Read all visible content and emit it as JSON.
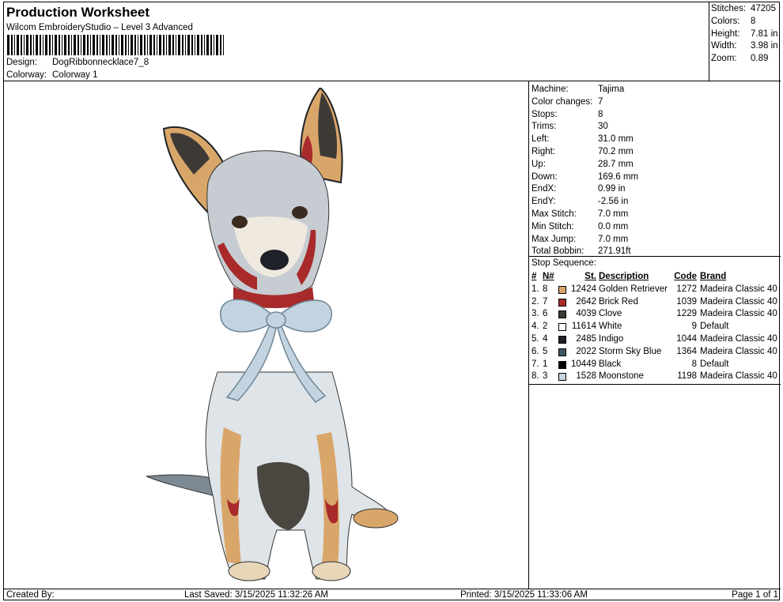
{
  "header": {
    "title": "Production Worksheet",
    "subtitle": "Wilcom EmbroideryStudio – Level 3 Advanced",
    "design_label": "Design:",
    "design_value": "DogRibbonnecklace7_8",
    "colorway_label": "Colorway:",
    "colorway_value": "Colorway 1"
  },
  "stats": [
    {
      "label": "Stitches:",
      "value": "47205"
    },
    {
      "label": "Colors:",
      "value": "8"
    },
    {
      "label": "Height:",
      "value": "7.81 in"
    },
    {
      "label": "Width:",
      "value": "3.98 in"
    },
    {
      "label": "Zoom:",
      "value": "0.89"
    }
  ],
  "machine_info": [
    {
      "label": "Machine:",
      "value": "Tajima"
    },
    {
      "label": "Color changes:",
      "value": "7"
    },
    {
      "label": "Stops:",
      "value": "8"
    },
    {
      "label": "Trims:",
      "value": "30"
    },
    {
      "label": "Left:",
      "value": "31.0 mm"
    },
    {
      "label": "Right:",
      "value": "70.2 mm"
    },
    {
      "label": "Up:",
      "value": "28.7 mm"
    },
    {
      "label": "Down:",
      "value": "169.6 mm"
    },
    {
      "label": "EndX:",
      "value": "0.99 in"
    },
    {
      "label": "EndY:",
      "value": "-2.56 in"
    },
    {
      "label": "Max Stitch:",
      "value": "7.0 mm"
    },
    {
      "label": "Min Stitch:",
      "value": "0.0 mm"
    },
    {
      "label": "Max Jump:",
      "value": "7.0 mm"
    },
    {
      "label": "Total Bobbin:",
      "value": "271.91ft"
    }
  ],
  "stop_sequence": {
    "title": "Stop Sequence:",
    "columns": {
      "num": "#",
      "n": "N#",
      "st": "St.",
      "description": "Description",
      "code": "Code",
      "brand": "Brand"
    },
    "rows": [
      {
        "num": "1.",
        "n": "8",
        "color": "#d9a66a",
        "st": "12424",
        "description": "Golden Retriever",
        "code": "1272",
        "brand": "Madeira Classic 40"
      },
      {
        "num": "2.",
        "n": "7",
        "color": "#a82a2a",
        "st": "2642",
        "description": "Brick Red",
        "code": "1039",
        "brand": "Madeira Classic 40"
      },
      {
        "num": "3.",
        "n": "6",
        "color": "#3d3a36",
        "st": "4039",
        "description": "Clove",
        "code": "1229",
        "brand": "Madeira Classic 40"
      },
      {
        "num": "4.",
        "n": "2",
        "color": "#ffffff",
        "st": "11614",
        "description": "White",
        "code": "9",
        "brand": "Default"
      },
      {
        "num": "5.",
        "n": "4",
        "color": "#1e2228",
        "st": "2485",
        "description": "Indigo",
        "code": "1044",
        "brand": "Madeira Classic 40"
      },
      {
        "num": "6.",
        "n": "5",
        "color": "#3e5564",
        "st": "2022",
        "description": "Storm Sky Blue",
        "code": "1364",
        "brand": "Madeira Classic 40"
      },
      {
        "num": "7.",
        "n": "1",
        "color": "#000000",
        "st": "10449",
        "description": "Black",
        "code": "8",
        "brand": "Default"
      },
      {
        "num": "8.",
        "n": "3",
        "color": "#c3d3e0",
        "st": "1528",
        "description": "Moonstone",
        "code": "1198",
        "brand": "Madeira Classic 40"
      }
    ]
  },
  "footer": {
    "created": "Created By:",
    "saved": "Last Saved: 3/15/2025 11:32:26 AM",
    "printed": "Printed: 3/15/2025 11:33:06 AM",
    "page": "Page 1 of 1"
  }
}
